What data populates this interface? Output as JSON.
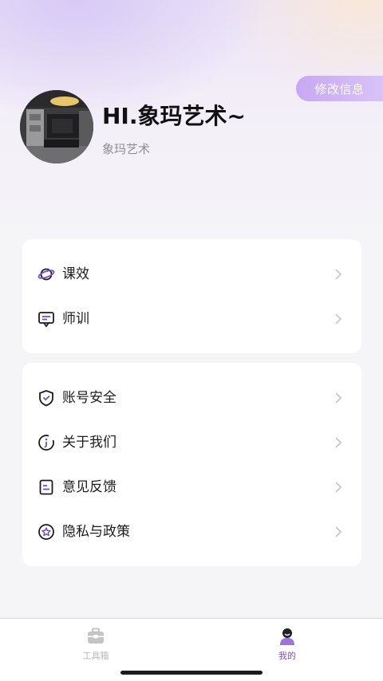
{
  "header": {
    "edit_label": "修改信息",
    "greeting": "HI.象玛艺术~",
    "subtitle": "象玛艺术"
  },
  "menu_group_1": [
    {
      "label": "课效",
      "icon": "planet-icon"
    },
    {
      "label": "师训",
      "icon": "chat-screen-icon"
    }
  ],
  "menu_group_2": [
    {
      "label": "账号安全",
      "icon": "shield-check-icon"
    },
    {
      "label": "关于我们",
      "icon": "info-circle-icon"
    },
    {
      "label": "意见反馈",
      "icon": "feedback-note-icon"
    },
    {
      "label": "隐私与政策",
      "icon": "privacy-star-icon"
    }
  ],
  "tabbar": {
    "tabs": [
      {
        "label": "工具箱",
        "icon": "toolbox-icon",
        "active": false
      },
      {
        "label": "我的",
        "icon": "user-profile-icon",
        "active": true
      }
    ]
  },
  "colors": {
    "accent": "#7a4fc4",
    "edit_button": "#c8a8f3",
    "inactive_tab": "#b8b8bd"
  }
}
